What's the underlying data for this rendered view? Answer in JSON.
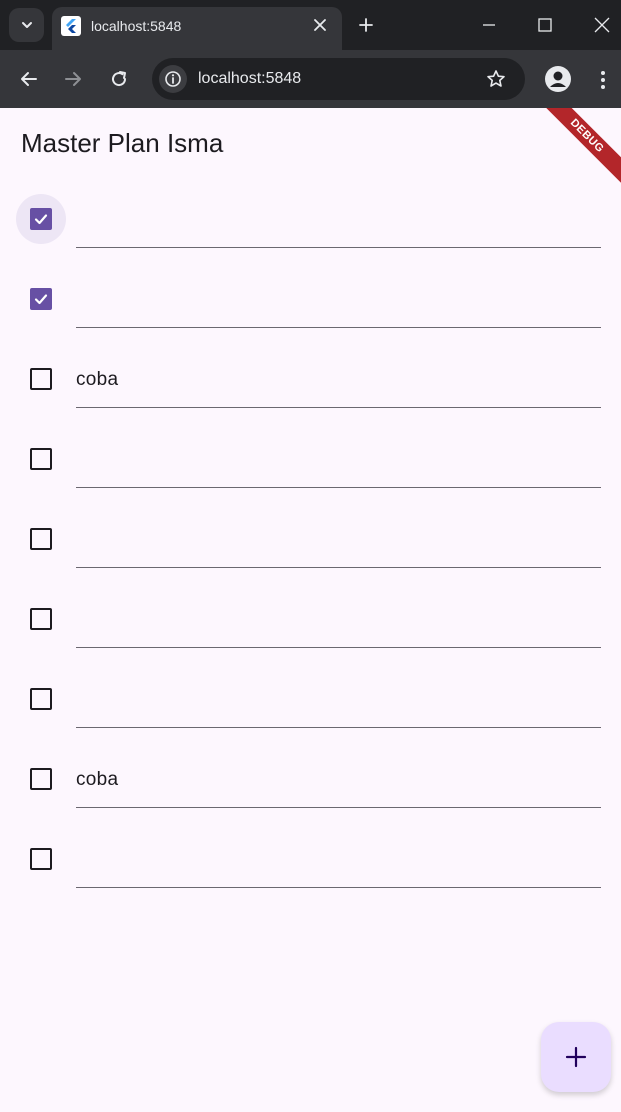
{
  "browser": {
    "tab_title": "localhost:5848",
    "url": "localhost:5848",
    "colors": {
      "chrome_bg": "#202124",
      "toolbar_bg": "#35363a",
      "text": "#e8eaed"
    }
  },
  "app": {
    "title": "Master Plan Isma",
    "debug_banner": "DEBUG",
    "colors": {
      "background": "#fdf7fe",
      "checkbox_checked": "#6750a4",
      "fab_bg": "#eaddff",
      "fab_icon": "#21005d"
    },
    "tasks": [
      {
        "checked": true,
        "text": ""
      },
      {
        "checked": true,
        "text": ""
      },
      {
        "checked": false,
        "text": "coba"
      },
      {
        "checked": false,
        "text": ""
      },
      {
        "checked": false,
        "text": ""
      },
      {
        "checked": false,
        "text": ""
      },
      {
        "checked": false,
        "text": ""
      },
      {
        "checked": false,
        "text": "coba"
      },
      {
        "checked": false,
        "text": ""
      }
    ],
    "fab_icon": "add-icon"
  }
}
